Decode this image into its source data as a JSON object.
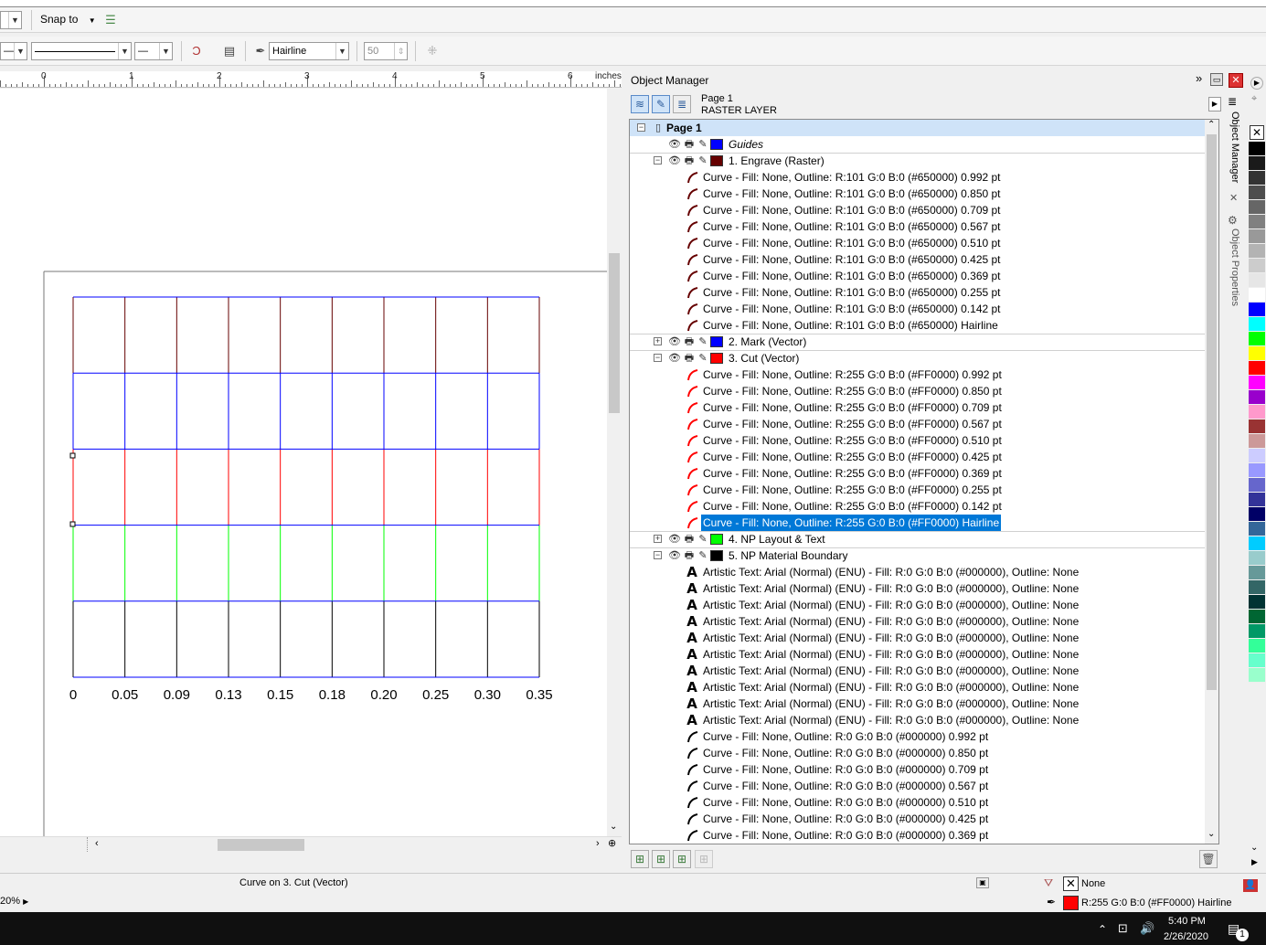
{
  "toolbar1": {
    "snap_label": "Snap to"
  },
  "toolbar2": {
    "outline_width": "Hairline",
    "spin_value": "50"
  },
  "ruler": {
    "unit": "inches",
    "labels": [
      "0",
      "1",
      "2",
      "3",
      "4",
      "5",
      "6"
    ]
  },
  "canvas": {
    "axis_labels": [
      "0",
      "0.05",
      "0.09",
      "0.13",
      "0.15",
      "0.18",
      "0.20",
      "0.25",
      "0.30",
      "0.35"
    ]
  },
  "object_manager": {
    "title": "Object Manager",
    "page_label": "Page 1",
    "layer_label": "RASTER LAYER",
    "tree_page": "Page 1",
    "guides": "Guides",
    "layers": {
      "engrave": "1. Engrave (Raster)",
      "mark": "2. Mark (Vector)",
      "cut": "3. Cut (Vector)",
      "np_layout": "4. NP Layout & Text",
      "np_boundary": "5. NP Material Boundary"
    },
    "engrave_items": [
      "Curve - Fill: None, Outline: R:101 G:0 B:0 (#650000)  0.992 pt",
      "Curve - Fill: None, Outline: R:101 G:0 B:0 (#650000)  0.850 pt",
      "Curve - Fill: None, Outline: R:101 G:0 B:0 (#650000)  0.709 pt",
      "Curve - Fill: None, Outline: R:101 G:0 B:0 (#650000)  0.567 pt",
      "Curve - Fill: None, Outline: R:101 G:0 B:0 (#650000)  0.510 pt",
      "Curve - Fill: None, Outline: R:101 G:0 B:0 (#650000)  0.425 pt",
      "Curve - Fill: None, Outline: R:101 G:0 B:0 (#650000)  0.369 pt",
      "Curve - Fill: None, Outline: R:101 G:0 B:0 (#650000)  0.255 pt",
      "Curve - Fill: None, Outline: R:101 G:0 B:0 (#650000)  0.142 pt",
      "Curve - Fill: None, Outline: R:101 G:0 B:0 (#650000)  Hairline"
    ],
    "cut_items": [
      "Curve - Fill: None, Outline: R:255 G:0 B:0 (#FF0000)  0.992 pt",
      "Curve - Fill: None, Outline: R:255 G:0 B:0 (#FF0000)  0.850 pt",
      "Curve - Fill: None, Outline: R:255 G:0 B:0 (#FF0000)  0.709 pt",
      "Curve - Fill: None, Outline: R:255 G:0 B:0 (#FF0000)  0.567 pt",
      "Curve - Fill: None, Outline: R:255 G:0 B:0 (#FF0000)  0.510 pt",
      "Curve - Fill: None, Outline: R:255 G:0 B:0 (#FF0000)  0.425 pt",
      "Curve - Fill: None, Outline: R:255 G:0 B:0 (#FF0000)  0.369 pt",
      "Curve - Fill: None, Outline: R:255 G:0 B:0 (#FF0000)  0.255 pt",
      "Curve - Fill: None, Outline: R:255 G:0 B:0 (#FF0000)  0.142 pt",
      "Curve - Fill: None, Outline: R:255 G:0 B:0 (#FF0000)  Hairline"
    ],
    "boundary_items": [
      "Artistic Text: Arial (Normal) (ENU) - Fill: R:0 G:0 B:0 (#000000), Outline: None",
      "Artistic Text: Arial (Normal) (ENU) - Fill: R:0 G:0 B:0 (#000000), Outline: None",
      "Artistic Text: Arial (Normal) (ENU) - Fill: R:0 G:0 B:0 (#000000), Outline: None",
      "Artistic Text: Arial (Normal) (ENU) - Fill: R:0 G:0 B:0 (#000000), Outline: None",
      "Artistic Text: Arial (Normal) (ENU) - Fill: R:0 G:0 B:0 (#000000), Outline: None",
      "Artistic Text: Arial (Normal) (ENU) - Fill: R:0 G:0 B:0 (#000000), Outline: None",
      "Artistic Text: Arial (Normal) (ENU) - Fill: R:0 G:0 B:0 (#000000), Outline: None",
      "Artistic Text: Arial (Normal) (ENU) - Fill: R:0 G:0 B:0 (#000000), Outline: None",
      "Artistic Text: Arial (Normal) (ENU) - Fill: R:0 G:0 B:0 (#000000), Outline: None",
      "Artistic Text: Arial (Normal) (ENU) - Fill: R:0 G:0 B:0 (#000000), Outline: None",
      "Curve - Fill: None, Outline: R:0 G:0 B:0 (#000000)  0.992 pt",
      "Curve - Fill: None, Outline: R:0 G:0 B:0 (#000000)  0.850 pt",
      "Curve - Fill: None, Outline: R:0 G:0 B:0 (#000000)  0.709 pt",
      "Curve - Fill: None, Outline: R:0 G:0 B:0 (#000000)  0.567 pt",
      "Curve - Fill: None, Outline: R:0 G:0 B:0 (#000000)  0.510 pt",
      "Curve - Fill: None, Outline: R:0 G:0 B:0 (#000000)  0.425 pt",
      "Curve - Fill: None, Outline: R:0 G:0 B:0 (#000000)  0.369 pt"
    ],
    "side_tabs": {
      "manager": "Object Manager",
      "properties": "Object Properties"
    }
  },
  "status": {
    "selection": "Curve on 3. Cut (Vector)",
    "zoom": "20%",
    "fill_label": "None",
    "outline_label": "R:255 G:0 B:0 (#FF0000)  Hairline"
  },
  "taskbar": {
    "time": "5:40 PM",
    "date": "2/26/2020",
    "notify_count": "1"
  },
  "colors": {
    "engrave": "#650000",
    "mark": "#0000ff",
    "cut": "#ff0000",
    "np_layout": "#00ff00",
    "boundary": "#000000",
    "guides": "#0000ff",
    "selection": "#0078d7"
  },
  "palette": [
    "#ffffff",
    "#000000",
    "#1a1a1a",
    "#333333",
    "#4d4d4d",
    "#666666",
    "#808080",
    "#999999",
    "#b3b3b3",
    "#cccccc",
    "#e6e6e6",
    "#ffffff",
    "#0000ff",
    "#00ffff",
    "#00ff00",
    "#ffff00",
    "#ff0000",
    "#ff00ff",
    "#9900cc",
    "#ff99cc",
    "#993333",
    "#cc9999",
    "#ccccff",
    "#9999ff",
    "#6666cc",
    "#333399",
    "#000066",
    "#336699",
    "#00ccff",
    "#99cccc",
    "#669999",
    "#336666",
    "#003333",
    "#006633",
    "#009966",
    "#33ff99",
    "#66ffcc",
    "#99ffcc"
  ]
}
